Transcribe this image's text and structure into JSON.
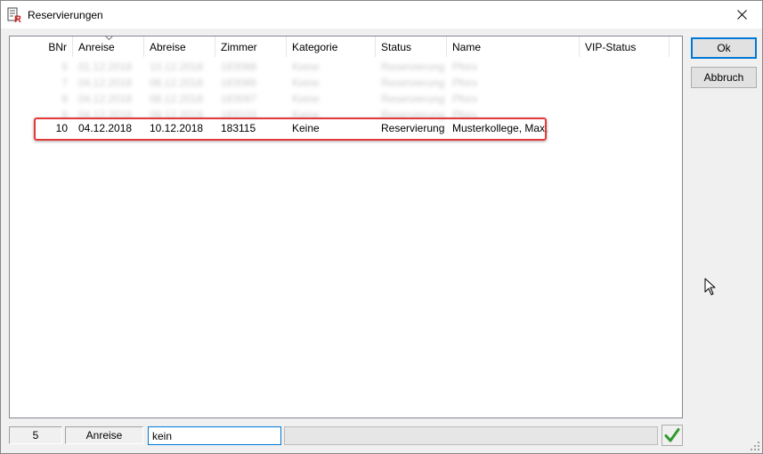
{
  "window": {
    "title": "Reservierungen"
  },
  "columns": [
    "BNr",
    "Anreise",
    "Abreise",
    "Zimmer",
    "Kategorie",
    "Status",
    "Name",
    "VIP-Status"
  ],
  "blurred_rows": [
    [
      "5",
      "01.12.2018",
      "10.12.2018",
      "183088",
      "Keine",
      "Reservierung",
      "Pforx"
    ],
    [
      "7",
      "04.12.2018",
      "08.12.2018",
      "183086",
      "Keine",
      "Reservierung",
      "Pforx"
    ],
    [
      "8",
      "04.12.2018",
      "08.12.2018",
      "183097",
      "Keine",
      "Reservierung",
      "Pforx"
    ],
    [
      "9",
      "04.12.2018",
      "09.12.2018",
      "183103",
      "Keine",
      "Reservierung",
      "Pforx"
    ]
  ],
  "selected_row": {
    "bnr": "10",
    "anreise": "04.12.2018",
    "abreise": "10.12.2018",
    "zimmer": "183115",
    "kategorie": "Keine",
    "status": "Reservierung",
    "name": "Musterkollege, Max,",
    "vip": ""
  },
  "buttons": {
    "ok": "Ok",
    "cancel": "Abbruch"
  },
  "status_bar": {
    "count": "5",
    "sort_field": "Anreise",
    "search_value": "kein"
  },
  "icons": {
    "app": "app-r-icon",
    "close": "close-icon",
    "sort": "sort-down-icon",
    "confirm": "checkmark-icon",
    "cursor": "mouse-pointer-icon"
  },
  "colors": {
    "highlight": "#e53a3a",
    "accent": "#0078d7",
    "check": "#2e9a2e"
  }
}
